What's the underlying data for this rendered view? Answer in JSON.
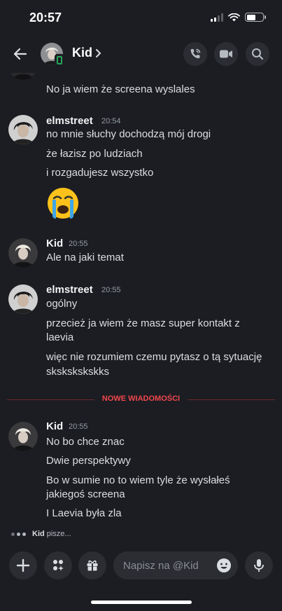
{
  "status_bar": {
    "time": "20:57"
  },
  "header": {
    "name": "Kid"
  },
  "messages": [
    {
      "text": "No ja wiem że screena wyslales"
    },
    {
      "author": "elmstreet",
      "time": "20:54",
      "lines": [
        "no mnie słuchy dochodzą mój drogi",
        "że łazisz po ludziach",
        "i rozgadujesz wszystko"
      ],
      "emoji": "loudly-crying-face"
    },
    {
      "author": "Kid",
      "time": "20:55",
      "lines": [
        "Ale na jaki temat"
      ]
    },
    {
      "author": "elmstreet",
      "time": "20:55",
      "lines": [
        "ogólny",
        "przecież ja wiem że masz super kontakt z",
        "laevia",
        "więc nie rozumiem czemu pytasz o tą sytuację",
        "skskskskskks"
      ]
    },
    {
      "author": "Kid",
      "time": "20:55",
      "lines": [
        "No bo chce znac",
        "Dwie perspektywy",
        "Bo w sumie no to wiem tyle że wysłałeś",
        "jakiegoś screena",
        "I Laevia była zla"
      ]
    }
  ],
  "divider": {
    "label": "NOWE WIADOMOŚCI"
  },
  "typing": {
    "name": "Kid",
    "text": "pisze..."
  },
  "composer": {
    "placeholder": "Napisz na @Kid"
  },
  "colors": {
    "background": "#1c1d22",
    "new_messages": "#f0474d",
    "online": "#23a55a"
  },
  "icons": [
    "back-arrow-icon",
    "chevron-right-icon",
    "phone-call-icon",
    "video-camera-icon",
    "search-icon",
    "plus-icon",
    "apps-icon",
    "gift-icon",
    "emoji-icon",
    "microphone-icon"
  ]
}
